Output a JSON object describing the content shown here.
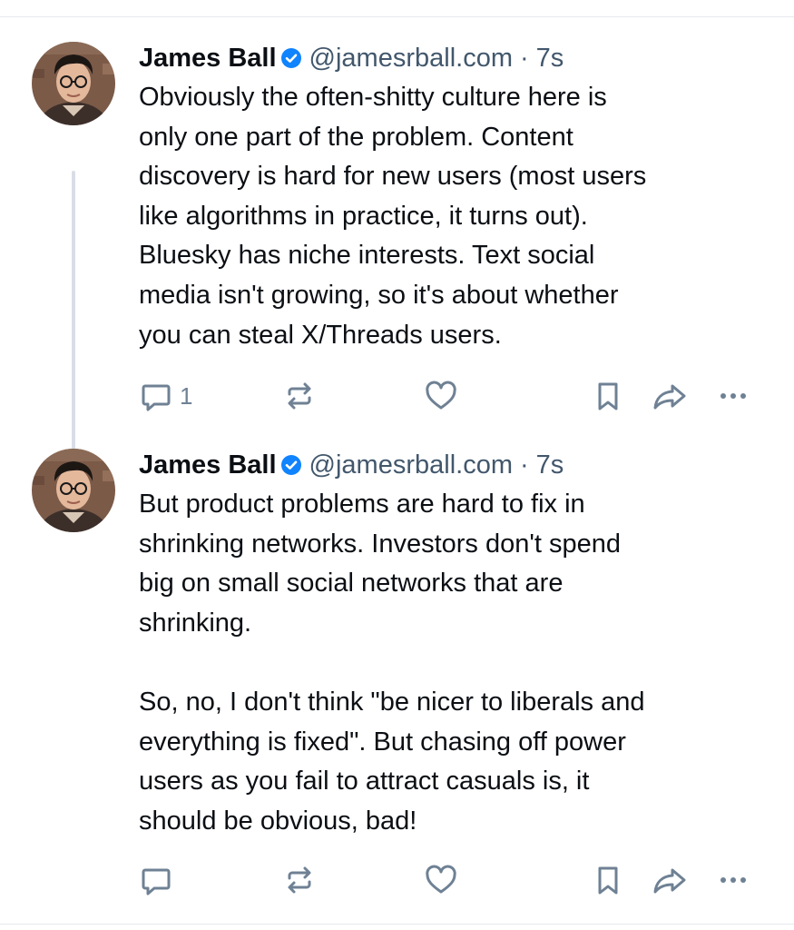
{
  "posts": [
    {
      "author": "James Ball",
      "handle": "@jamesrball.com",
      "separator": "·",
      "time": "7s",
      "text": "Obviously the often-shitty culture here is\nonly one part of the problem. Content\ndiscovery is hard for new users (most users\nlike algorithms in practice, it turns out).\nBluesky has niche interests. Text social\nmedia isn't growing, so it's about whether\nyou can steal X/Threads users.",
      "reply_count": "1"
    },
    {
      "author": "James Ball",
      "handle": "@jamesrball.com",
      "separator": "·",
      "time": "7s",
      "text": "But product problems are hard to fix in\nshrinking networks. Investors don't spend\nbig on small social networks that are\nshrinking.\n\nSo, no, I don't think \"be nicer to liberals and\neverything is fixed\". But chasing off power\nusers as you fail to attract casuals is, it\nshould be obvious, bad!",
      "reply_count": ""
    }
  ],
  "icons": {
    "verified": "verified-badge-icon",
    "reply": "reply-icon",
    "repost": "repost-icon",
    "like": "heart-icon",
    "bookmark": "bookmark-icon",
    "share": "share-icon",
    "more": "more-icon"
  },
  "colors": {
    "verified_blue": "#1083fe",
    "icon_gray": "#6f8194",
    "handle_gray": "#42576c",
    "thread_line": "#d9dee6"
  }
}
